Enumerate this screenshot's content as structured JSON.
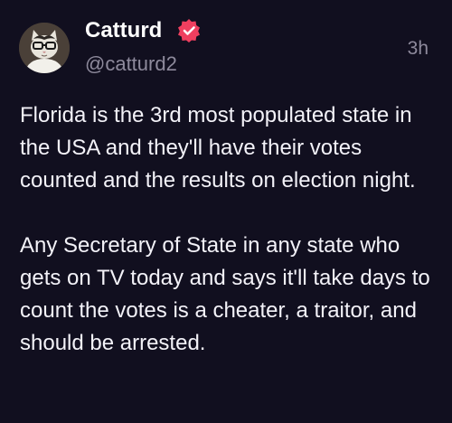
{
  "post": {
    "author": {
      "display_name": "Catturd",
      "handle": "@catturd2",
      "verified_icon": "verified-badge-icon",
      "avatar_icon": "cat-with-glasses-avatar"
    },
    "timestamp": "3h",
    "paragraphs": [
      "Florida is the 3rd most populated state in the USA and they'll have their votes counted and the results on election night.",
      "Any Secretary of State in any state who gets on TV today and says it'll take days to count the votes is a cheater, a traitor, and should be arrested."
    ]
  },
  "colors": {
    "background": "#110f1f",
    "text": "#f3f2f8",
    "secondary_text": "#8e8a9c",
    "verified_badge": "#ef3f5f"
  }
}
